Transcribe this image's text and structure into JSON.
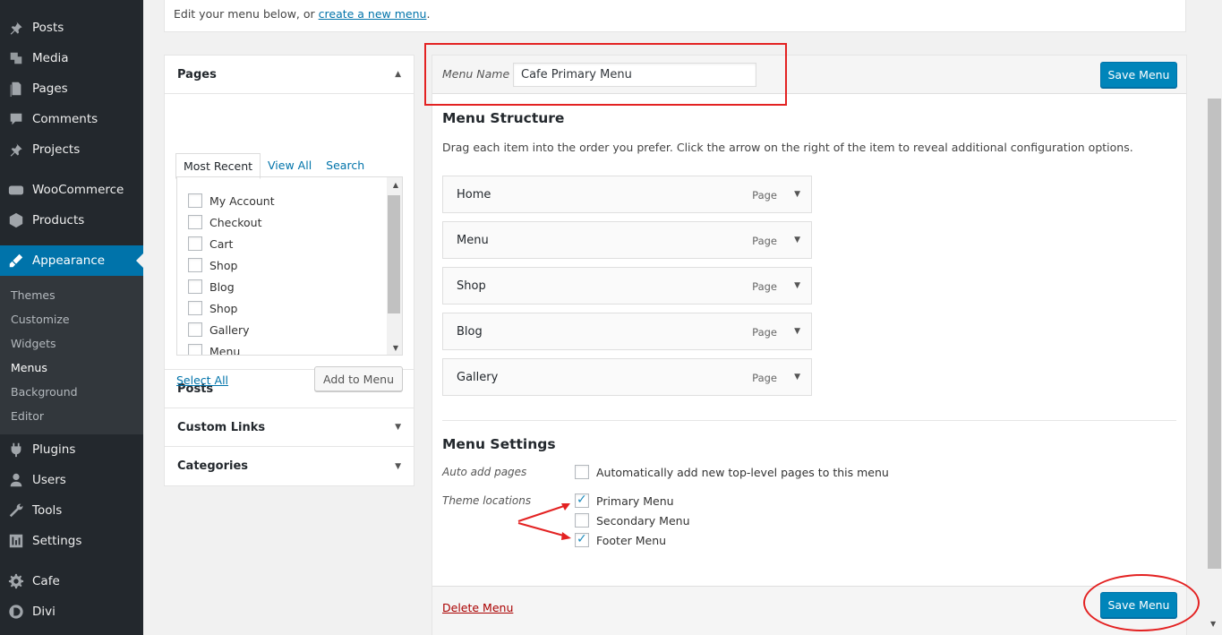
{
  "sidebar": {
    "items": [
      {
        "label": "Posts",
        "icon": "pin-icon"
      },
      {
        "label": "Media",
        "icon": "media-icon"
      },
      {
        "label": "Pages",
        "icon": "pages-icon"
      },
      {
        "label": "Comments",
        "icon": "comment-icon"
      },
      {
        "label": "Projects",
        "icon": "pin-icon"
      },
      {
        "label": "WooCommerce",
        "icon": "woo-icon"
      },
      {
        "label": "Products",
        "icon": "box-icon"
      },
      {
        "label": "Appearance",
        "icon": "brush-icon"
      },
      {
        "label": "Plugins",
        "icon": "plug-icon"
      },
      {
        "label": "Users",
        "icon": "user-icon"
      },
      {
        "label": "Tools",
        "icon": "wrench-icon"
      },
      {
        "label": "Settings",
        "icon": "settings-icon"
      },
      {
        "label": "Cafe",
        "icon": "gear-icon"
      },
      {
        "label": "Divi",
        "icon": "divi-icon"
      }
    ],
    "appearance_sub": [
      "Themes",
      "Customize",
      "Widgets",
      "Menus",
      "Background",
      "Editor"
    ]
  },
  "manage": {
    "text": "Edit your menu below, or",
    "link": "create a new menu",
    "suffix": "."
  },
  "left": {
    "pages_title": "Pages",
    "tabs": [
      "Most Recent",
      "View All",
      "Search"
    ],
    "pages": [
      "My Account",
      "Checkout",
      "Cart",
      "Shop",
      "Blog",
      "Shop",
      "Gallery",
      "Menu"
    ],
    "select_all": "Select All",
    "add_to_menu": "Add to Menu",
    "sections": [
      "Posts",
      "Custom Links",
      "Categories"
    ]
  },
  "menu": {
    "name_label": "Menu Name",
    "name_value": "Cafe Primary Menu",
    "save": "Save Menu",
    "structure_title": "Menu Structure",
    "structure_desc": "Drag each item into the order you prefer. Click the arrow on the right of the item to reveal additional configuration options.",
    "items": [
      {
        "title": "Home",
        "type": "Page"
      },
      {
        "title": "Menu",
        "type": "Page"
      },
      {
        "title": "Shop",
        "type": "Page"
      },
      {
        "title": "Blog",
        "type": "Page"
      },
      {
        "title": "Gallery",
        "type": "Page"
      }
    ],
    "settings_title": "Menu Settings",
    "auto_add_label": "Auto add pages",
    "auto_add_text": "Automatically add new top-level pages to this menu",
    "auto_add_checked": false,
    "locations_label": "Theme locations",
    "locations": [
      {
        "label": "Primary Menu",
        "checked": true
      },
      {
        "label": "Secondary Menu",
        "checked": false
      },
      {
        "label": "Footer Menu",
        "checked": true
      }
    ],
    "delete": "Delete Menu"
  },
  "colors": {
    "accent": "#0073aa",
    "primary_button": "#0085ba",
    "sidebar": "#23282d",
    "annotation": "#e32222"
  }
}
